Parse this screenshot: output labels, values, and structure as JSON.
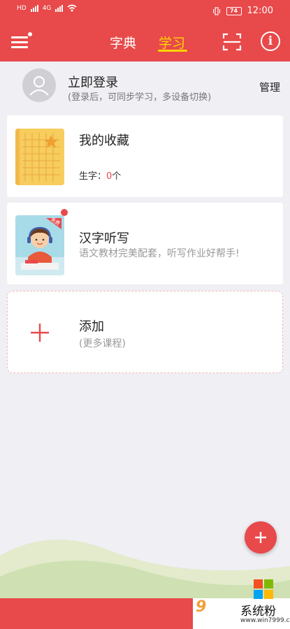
{
  "status_bar": {
    "network_labels": [
      "HD",
      "4G",
      "4G"
    ],
    "battery": "74",
    "time": "12:00"
  },
  "header": {
    "tabs": [
      {
        "label": "字典",
        "active": false
      },
      {
        "label": "学习",
        "active": true
      }
    ],
    "icons": [
      "menu-icon",
      "scan-icon",
      "info-icon"
    ],
    "info_glyph": "i",
    "accent_color": "#e8494a",
    "active_tab_color": "#ffd700"
  },
  "login": {
    "title": "立即登录",
    "subtitle": "(登录后，可同步学习，多设备切换)",
    "manage_label": "管理"
  },
  "cards": {
    "favorites": {
      "title": "我的收藏",
      "count_label": "生字：",
      "count_value": "0",
      "count_unit": "个"
    },
    "dictation": {
      "title": "汉字听写",
      "subtitle": "语文教材完美配套，听写作业好帮手!",
      "badge": "免费"
    },
    "add": {
      "title": "添加",
      "subtitle": "(更多课程)"
    }
  },
  "watermark": {
    "brand": "系统粉",
    "url": "www.win7999.com",
    "logo_text": "9"
  }
}
